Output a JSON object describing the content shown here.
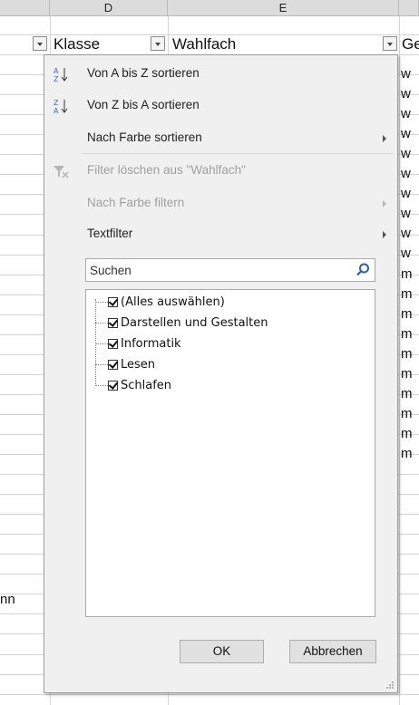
{
  "columns": {
    "d": "D",
    "e": "E"
  },
  "headers": {
    "klasse": "Klasse",
    "wahlfach": "Wahlfach",
    "next": "Ge"
  },
  "g_column": [
    "w",
    "w",
    "w",
    "w",
    "w",
    "w",
    "w",
    "w",
    "w",
    "w",
    "m",
    "m",
    "m",
    "m",
    "m",
    "m",
    "m",
    "m",
    "m",
    "m"
  ],
  "left_fragment": "nn",
  "menu": {
    "sort_az": "Von A bis Z sortieren",
    "sort_za": "Von Z bis A sortieren",
    "sort_color": "Nach Farbe sortieren",
    "clear_filter": "Filter löschen aus \"Wahlfach\"",
    "filter_color": "Nach Farbe filtern",
    "text_filter": "Textfilter"
  },
  "search": {
    "placeholder": "Suchen"
  },
  "list_items": [
    {
      "label": "(Alles auswählen)",
      "checked": true
    },
    {
      "label": "Darstellen und Gestalten",
      "checked": true
    },
    {
      "label": "Informatik",
      "checked": true
    },
    {
      "label": "Lesen",
      "checked": true
    },
    {
      "label": "Schlafen",
      "checked": true
    }
  ],
  "buttons": {
    "ok": "OK",
    "cancel": "Abbrechen"
  },
  "colors": {
    "panel_bg": "#f0f0f0",
    "grid": "#d4d4d4",
    "disabled_text": "#a0a0a0"
  }
}
